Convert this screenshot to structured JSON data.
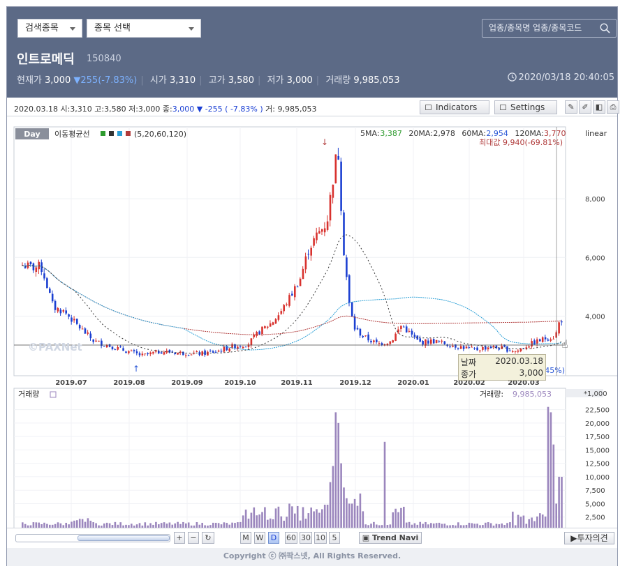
{
  "header": {
    "search_type": "검색종목",
    "stock_select": "종목 선택",
    "search_placeholder": "업종/종목명 업종/종목코드",
    "stock_name": "인트로메딕",
    "stock_code": "150840",
    "current_label": "현재가",
    "current_value": "3,000",
    "change": "▼255(-7.83%)",
    "open_label": "시가",
    "open_value": "3,310",
    "high_label": "고가",
    "high_value": "3,580",
    "low_label": "저가",
    "low_value": "3,000",
    "volume_label": "거래량",
    "volume_value": "9,985,053",
    "datetime": "2020/03/18 20:40:05"
  },
  "infobar": {
    "summary_prefix": "2020.03.18 시:3,310 고:3,580 저:3,000 종:",
    "close": "3,000 ▼",
    "change": " -255 ( -7.83% )",
    "summary_suffix": " 거: 9,985,053",
    "indicators_label": "Indicators",
    "settings_label": "Settings"
  },
  "chart": {
    "day_badge": "Day",
    "ma_legend": "이동평균선",
    "ma_legend_params": "(5,20,60,120)",
    "ma_values": [
      {
        "label": "5MA:",
        "value": "3,387",
        "color": "#2e9b2e"
      },
      {
        "label": "20MA:",
        "value": "2,978",
        "color": "#333333"
      },
      {
        "label": "60MA:",
        "value": "2,954",
        "color": "#2a57d6"
      },
      {
        "label": "120MA:",
        "value": "3,770",
        "color": "#b03a3a"
      }
    ],
    "max_label": "최대값 9,940(-69.81%)",
    "min_label_fragment": "45%)",
    "scale_label": "linear",
    "price_ticks": [
      "8,000",
      "6,000",
      "4,000"
    ],
    "date_ticks": [
      "2019.07",
      "2019.08",
      "2019.09",
      "2019.10",
      "2019.11",
      "2019.12",
      "2020.01",
      "2020.02",
      "2020.03"
    ],
    "volume_title": "거래량",
    "volume_label": "거래량:",
    "volume_value": "9,985,053",
    "volume_unit": "*1,000",
    "volume_ticks": [
      "22,500",
      "20,000",
      "17,500",
      "15,000",
      "12,500",
      "10,000",
      "7,500",
      "5,000",
      "2,500"
    ],
    "watermark": "©PAXNet",
    "colors": {
      "up": "#d8322e",
      "down": "#1b3fd1",
      "ma5": "#2e9b2e",
      "ma20": "#333333",
      "ma60": "#2a9fd6",
      "ma120": "#b03a3a",
      "volume": "#9b86bd"
    }
  },
  "tooltip": {
    "date_label": "날짜",
    "date_value": "2020.03.18",
    "close_label": "종가",
    "close_value": "3,000"
  },
  "toolbar": {
    "periods": [
      "M",
      "W",
      "D",
      "60",
      "30",
      "10",
      "5"
    ],
    "active_period": "D",
    "trend_label": "Trend Navi",
    "opinion_label": "투자의견"
  },
  "footer": {
    "copyright": "Copyright ⓒ ㈜팍스넷, All Rights Reserved."
  },
  "chart_data": {
    "type": "candlestick",
    "title": "인트로메딕 150840",
    "x_dates": [
      "2019.07",
      "2019.08",
      "2019.09",
      "2019.10",
      "2019.11",
      "2019.12",
      "2020.01",
      "2020.02",
      "2020.03"
    ],
    "close_by_month_start": [
      5700,
      3100,
      2700,
      2900,
      6500,
      3200,
      3000,
      2800,
      3000
    ],
    "max_price": 9940,
    "last_close": 3000,
    "ylim": [
      2300,
      10000
    ],
    "moving_averages": {
      "5MA": 3387,
      "20MA": 2978,
      "60MA": 2954,
      "120MA": 3770
    },
    "volume": {
      "last": 9985053,
      "unit": "*1,000",
      "ylim": [
        0,
        24000
      ],
      "max_approx": 23000
    }
  }
}
